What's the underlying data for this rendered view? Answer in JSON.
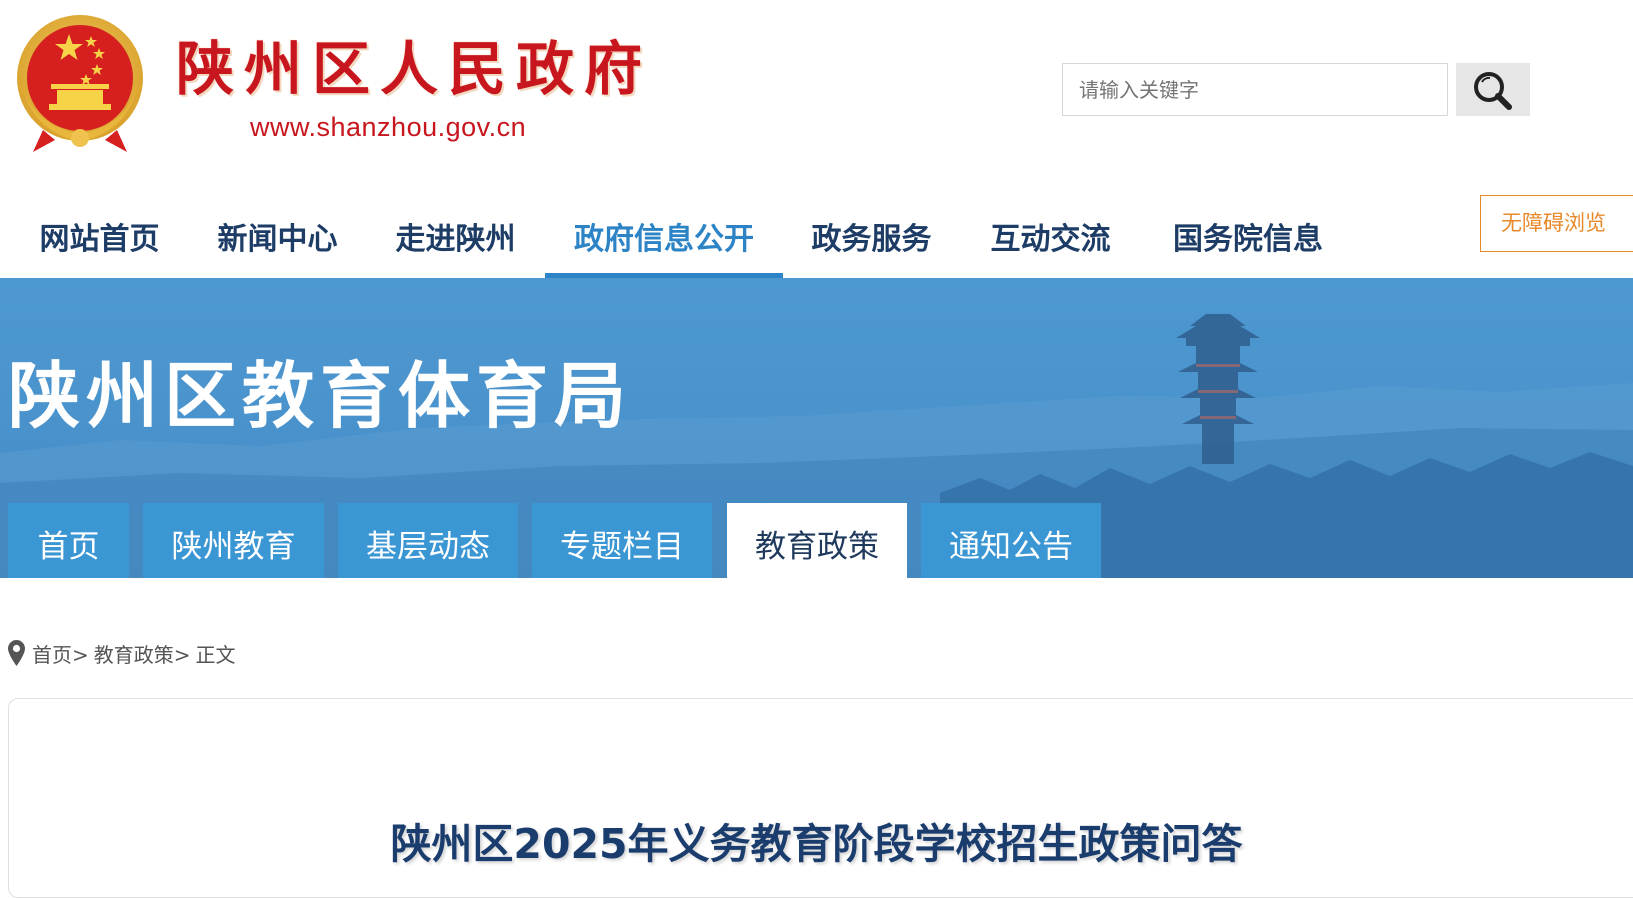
{
  "header": {
    "site_name": "陕州区人民政府",
    "site_url": "www.shanzhou.gov.cn",
    "emblem_icon": "national-emblem-icon",
    "search": {
      "placeholder": "请输入关键字",
      "value": "",
      "button_icon": "search-icon"
    }
  },
  "topnav": {
    "items": [
      {
        "label": "网站首页"
      },
      {
        "label": "新闻中心"
      },
      {
        "label": "走进陕州"
      },
      {
        "label": "政府信息公开",
        "active": true
      },
      {
        "label": "政务服务"
      },
      {
        "label": "互动交流"
      },
      {
        "label": "国务院信息"
      }
    ],
    "accessibility_label": "无障碍浏览"
  },
  "banner": {
    "title": "陕州区教育体育局",
    "subnav": [
      {
        "label": "首页"
      },
      {
        "label": "陕州教育"
      },
      {
        "label": "基层动态"
      },
      {
        "label": "专题栏目"
      },
      {
        "label": "教育政策",
        "active": true
      },
      {
        "label": "通知公告"
      }
    ]
  },
  "breadcrumb": {
    "icon": "location-pin-icon",
    "items": [
      "首页>",
      "教育政策>",
      "正文"
    ]
  },
  "article": {
    "title": "陕州区2025年义务教育阶段学校招生政策问答"
  },
  "colors": {
    "brand_red": "#c8161e",
    "nav_text": "#1d3c66",
    "nav_active": "#2c83c5",
    "banner_blue": "#4a93cd",
    "subnav_blue": "#3b96d4",
    "accessibility_orange": "#e8892a",
    "article_title": "#1a3d6e"
  }
}
